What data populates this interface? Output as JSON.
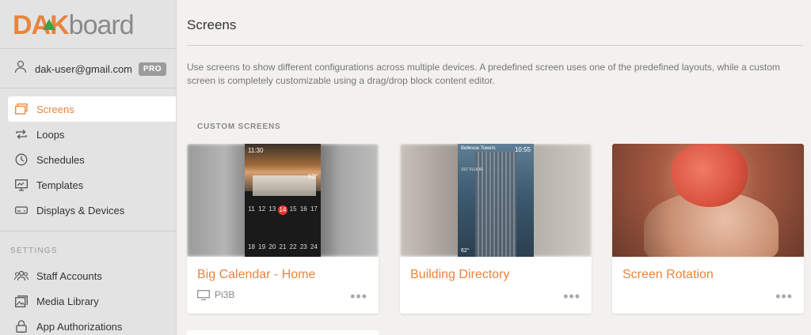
{
  "brand": {
    "logo_part1": "DAK",
    "logo_part2": "board",
    "accent_color": "#e8843d",
    "logo_triangle_color": "#3ea04a"
  },
  "user": {
    "email": "dak-user@gmail.com",
    "badge": "PRO"
  },
  "nav": {
    "items": [
      {
        "label": "Screens",
        "icon": "screens-icon",
        "active": true
      },
      {
        "label": "Loops",
        "icon": "loops-icon"
      },
      {
        "label": "Schedules",
        "icon": "clock-icon"
      },
      {
        "label": "Templates",
        "icon": "templates-icon"
      },
      {
        "label": "Displays & Devices",
        "icon": "devices-icon"
      }
    ],
    "settings_label": "SETTINGS",
    "settings_items": [
      {
        "label": "Staff Accounts",
        "icon": "staff-icon"
      },
      {
        "label": "Media Library",
        "icon": "media-icon"
      },
      {
        "label": "App Authorizations",
        "icon": "lock-icon"
      }
    ]
  },
  "main": {
    "title": "Screens",
    "description": "Use screens to show different configurations across multiple devices. A predefined screen uses one of the predefined layouts, while a custom screen is completely customizable using a drag/drop block content editor.",
    "section_label": "CUSTOM SCREENS",
    "cards": [
      {
        "name": "Big Calendar - Home",
        "device": "Pi3B",
        "more": "•••",
        "thumb": {
          "time": "11:30",
          "temp": "62°",
          "week1": [
            "11",
            "12",
            "13",
            "14",
            "15",
            "16",
            "17"
          ],
          "week2": [
            "18",
            "19",
            "20",
            "21",
            "22",
            "23",
            "24"
          ]
        }
      },
      {
        "name": "Building Directory",
        "more": "•••",
        "thumb": {
          "header": "Bellevue Towers",
          "time": "10:55",
          "floor": "1ST FLOOR",
          "temp": "62°"
        }
      },
      {
        "name": "Screen Rotation",
        "more": "•••"
      }
    ]
  }
}
